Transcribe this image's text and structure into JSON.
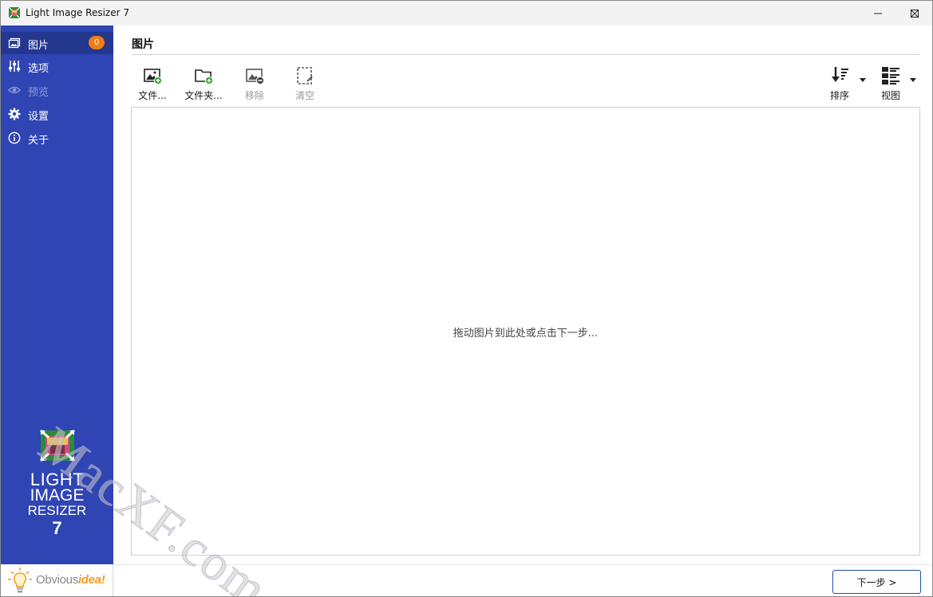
{
  "window": {
    "title": "Light Image Resizer 7"
  },
  "sidebar": {
    "items": [
      {
        "label": "图片",
        "icon": "pictures-icon",
        "active": true,
        "badge": "0"
      },
      {
        "label": "选项",
        "icon": "sliders-icon"
      },
      {
        "label": "预览",
        "icon": "eye-icon",
        "disabled": true
      },
      {
        "label": "设置",
        "icon": "gear-icon"
      },
      {
        "label": "关于",
        "icon": "info-icon"
      }
    ],
    "logo": {
      "line1": "LIGHT",
      "line2": "IMAGE",
      "line3": "RESIZER",
      "line4": "7"
    },
    "brand": {
      "name_plain": "Obvious",
      "name_emph": "idea!"
    }
  },
  "main": {
    "title": "图片",
    "toolbar": {
      "files_label": "文件...",
      "folder_label": "文件夹...",
      "remove_label": "移除",
      "clear_label": "清空",
      "sort_label": "排序",
      "view_label": "视图"
    },
    "drop_hint": "拖动图片到此处或点击下一步...",
    "next_button": "下一步 >"
  },
  "watermark": "MacXF.com",
  "colors": {
    "sidebar": "#2f45b4",
    "sidebar_active": "#23378f",
    "badge": "#f07c1a",
    "add_green": "#2aa52a"
  }
}
